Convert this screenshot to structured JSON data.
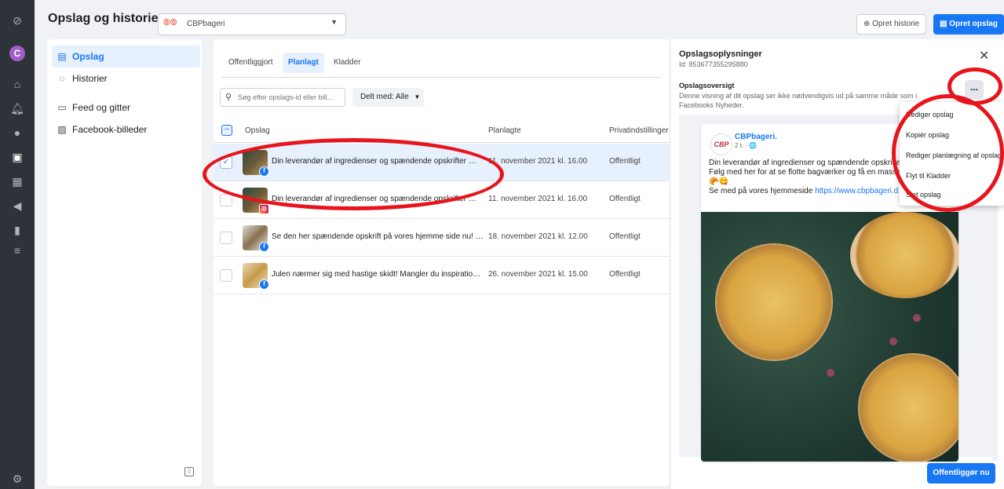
{
  "header": {
    "title": "Opslag og historier",
    "account_name": "CBPbageri",
    "create_story": "Opret historie",
    "create_post": "Opret opslag"
  },
  "sidebar": {
    "items": [
      {
        "label": "Opslag",
        "icon": "posts-icon"
      },
      {
        "label": "Historier",
        "icon": "stories-icon"
      },
      {
        "label": "Feed og gitter",
        "icon": "feed-grid-icon"
      },
      {
        "label": "Facebook-billeder",
        "icon": "photos-icon"
      }
    ]
  },
  "list": {
    "tabs": [
      "Offentliggjort",
      "Planlagt",
      "Kladder"
    ],
    "active_tab": "Planlagt",
    "search_placeholder": "Søg efter opslags-id eller bill...",
    "filter_label": "Delt med: Alle",
    "columns": [
      "Opslag",
      "Planlagte",
      "Privatindstillinger"
    ],
    "rows": [
      {
        "text": "Din leverandør af ingredienser og spændende opskrifter 😀...",
        "date": "11. november 2021 kl. 16.00",
        "privacy": "Offentligt",
        "platform": "facebook",
        "selected": true
      },
      {
        "text": "Din leverandør af ingredienser og spændende opskrifter 😀...",
        "date": "11. november 2021 kl. 16.00",
        "privacy": "Offentligt",
        "platform": "instagram",
        "selected": false
      },
      {
        "text": "Se den her spændende opskrift på vores hjemme side nu! 😀",
        "date": "18. november 2021 kl. 12.00",
        "privacy": "Offentligt",
        "platform": "facebook",
        "selected": false
      },
      {
        "text": "Julen nærmer sig med hastige skidt! Mangler du inspiration ...",
        "date": "26. november 2021 kl. 15.00",
        "privacy": "Offentligt",
        "platform": "facebook",
        "selected": false
      }
    ]
  },
  "detail": {
    "title": "Opslagsoplysninger",
    "id": "Id: 853677355295880",
    "overview_title": "Opslagsoversigt",
    "overview_desc": "Denne visning af dit opslag ser ikke nødvendigvis ud på samme måde som i Facebooks Nyheder.",
    "more_label": "...",
    "preview": {
      "page_name": "CBPbageri.",
      "meta": "2 t. · 🌐",
      "line1": "Din leverandør af ingredienser og spændende opskrifte",
      "line2": "Følg med her for at se flotte bagværker og få en masse",
      "line3": "🥐😋",
      "line4_prefix": "Se med på vores hjemmeside ",
      "link": "https://www.cbpbageri.d"
    },
    "publish_label": "Offentliggør nu"
  },
  "menu": {
    "items": [
      "Rediger opslag",
      "Kopiér opslag",
      "Rediger planlægning af opslag",
      "Flyt til Kladder",
      "Slet opslag"
    ]
  },
  "colors": {
    "accent": "#1877f2",
    "annotation": "#e8141c"
  }
}
